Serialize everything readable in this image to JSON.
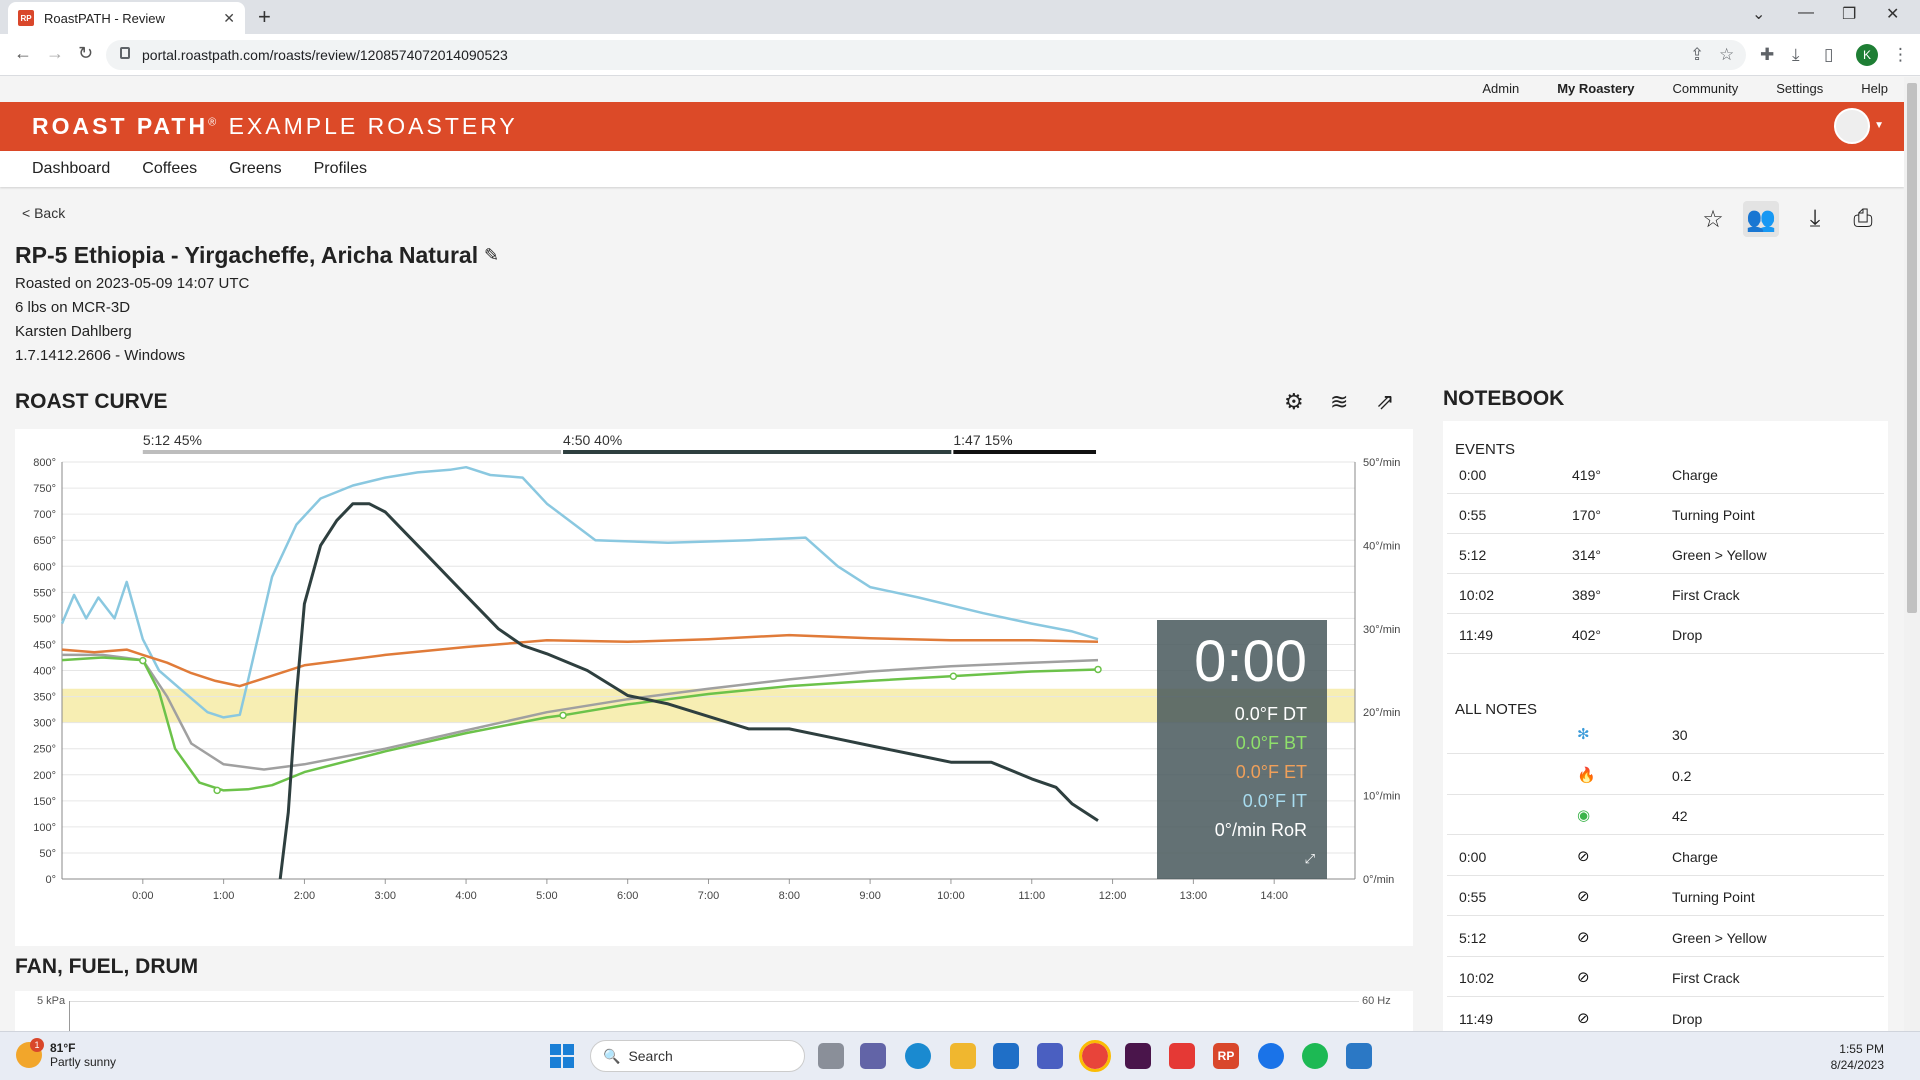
{
  "browser": {
    "tab_title": "RoastPATH - Review",
    "favicon_text": "RP",
    "url": "portal.roastpath.com/roasts/review/1208574072014090523",
    "profile_initial": "K"
  },
  "topnav": [
    "Admin",
    "My Roastery",
    "Community",
    "Settings",
    "Help"
  ],
  "brand": {
    "bold": "ROAST PATH",
    "rest": "EXAMPLE ROASTERY"
  },
  "mainnav": [
    "Dashboard",
    "Coffees",
    "Greens",
    "Profiles"
  ],
  "back_label": "< Back",
  "roast": {
    "title": "RP-5 Ethiopia - Yirgacheffe, Aricha Natural",
    "roasted_on": "Roasted on 2023-05-09 14:07 UTC",
    "batch": "6 lbs on MCR-3D",
    "roaster": "Karsten Dahlberg",
    "version": "1.7.1412.2606 - Windows"
  },
  "sections": {
    "roast_curve": "ROAST CURVE",
    "notebook": "NOTEBOOK",
    "fan_fuel_drum": "FAN, FUEL, DRUM",
    "events": "EVENTS",
    "all_notes": "ALL NOTES"
  },
  "readout": {
    "time": "0:00",
    "dt": "0.0°F DT",
    "bt": "0.0°F BT",
    "et": "0.0°F ET",
    "it": "0.0°F IT",
    "ror": "0°/min RoR"
  },
  "colors": {
    "brand": "#dc4a28",
    "bt": "#6cc24a",
    "et": "#e07b39",
    "it": "#8ac8e0",
    "ror": "#2e3f3f",
    "gray": "#a0a0a0",
    "band": "#f5eaa0"
  },
  "chart_data": {
    "type": "line",
    "xlabel": "",
    "ylabel": "",
    "x_ticks": [
      "0:00",
      "1:00",
      "2:00",
      "3:00",
      "4:00",
      "5:00",
      "6:00",
      "7:00",
      "8:00",
      "9:00",
      "10:00",
      "11:00",
      "12:00",
      "13:00",
      "14:00"
    ],
    "y_ticks": [
      "0°",
      "50°",
      "100°",
      "150°",
      "200°",
      "250°",
      "300°",
      "350°",
      "400°",
      "450°",
      "500°",
      "550°",
      "600°",
      "650°",
      "700°",
      "750°",
      "800°"
    ],
    "y2_ticks": [
      "0°/min",
      "10°/min",
      "20°/min",
      "30°/min",
      "40°/min",
      "50°/min"
    ],
    "xlim": [
      -1,
      15
    ],
    "ylim": [
      0,
      800
    ],
    "y2lim": [
      0,
      50
    ],
    "phases": [
      {
        "label": "5:12 45%",
        "start": 0,
        "end": 5.2,
        "color": "#bdbdbd"
      },
      {
        "label": "4:50 40%",
        "start": 5.2,
        "end": 10.03,
        "color": "#2e3f3f"
      },
      {
        "label": "1:47 15%",
        "start": 10.03,
        "end": 11.82,
        "color": "#111111"
      }
    ],
    "band": [
      300,
      365
    ],
    "series": [
      {
        "key": "it",
        "axis": "left",
        "x": [
          -1,
          -0.85,
          -0.7,
          -0.55,
          -0.35,
          -0.2,
          0,
          0.2,
          0.5,
          0.8,
          1.0,
          1.2,
          1.3,
          1.6,
          1.9,
          2.2,
          2.6,
          3.0,
          3.4,
          3.8,
          4.0,
          4.3,
          4.7,
          5.0,
          5.6,
          6.5,
          7.5,
          8.2,
          8.6,
          9.0,
          9.6,
          10.4,
          11.0,
          11.5,
          11.82
        ],
        "y": [
          490,
          545,
          500,
          540,
          500,
          570,
          460,
          400,
          360,
          320,
          310,
          315,
          380,
          580,
          680,
          730,
          755,
          770,
          780,
          785,
          790,
          775,
          770,
          720,
          650,
          645,
          650,
          655,
          600,
          560,
          540,
          510,
          490,
          475,
          460
        ]
      },
      {
        "key": "et",
        "axis": "left",
        "x": [
          -1,
          -0.6,
          -0.2,
          0,
          0.3,
          0.6,
          0.9,
          1.2,
          1.5,
          2.0,
          3.0,
          4.0,
          5.0,
          6.0,
          7.0,
          8.0,
          9.0,
          10.0,
          11.0,
          11.82
        ],
        "y": [
          440,
          435,
          440,
          430,
          415,
          395,
          380,
          370,
          385,
          410,
          430,
          445,
          458,
          455,
          460,
          468,
          462,
          458,
          458,
          455
        ]
      },
      {
        "key": "gray",
        "axis": "left",
        "x": [
          -1,
          -0.5,
          0,
          0.3,
          0.6,
          1.0,
          1.5,
          2.0,
          3.0,
          4.0,
          5.0,
          6.0,
          7.0,
          8.0,
          9.0,
          10.0,
          11.0,
          11.82
        ],
        "y": [
          430,
          430,
          420,
          350,
          260,
          220,
          210,
          220,
          250,
          285,
          320,
          345,
          365,
          383,
          398,
          408,
          415,
          420
        ]
      },
      {
        "key": "bt",
        "axis": "left",
        "x": [
          -1,
          -0.5,
          0,
          0.2,
          0.4,
          0.7,
          1.0,
          1.3,
          1.6,
          2.0,
          3.0,
          4.0,
          5.0,
          5.2,
          6.0,
          7.0,
          8.0,
          9.0,
          10.0,
          11.0,
          11.82
        ],
        "y": [
          420,
          425,
          420,
          360,
          250,
          185,
          170,
          172,
          180,
          205,
          245,
          280,
          310,
          314,
          335,
          355,
          370,
          380,
          389,
          398,
          402
        ]
      },
      {
        "key": "ror",
        "axis": "right",
        "x": [
          1.7,
          1.8,
          1.9,
          2.0,
          2.2,
          2.4,
          2.6,
          2.8,
          3.0,
          3.2,
          3.5,
          3.8,
          4.1,
          4.4,
          4.7,
          5.0,
          5.5,
          6.0,
          6.5,
          7.0,
          7.5,
          8.0,
          8.5,
          9.0,
          9.5,
          10.0,
          10.5,
          11.0,
          11.3,
          11.5,
          11.82
        ],
        "y": [
          0,
          8,
          22,
          33,
          40,
          43,
          45,
          45,
          44,
          42,
          39,
          36,
          33,
          30,
          28,
          27,
          25,
          22,
          21,
          19.5,
          18,
          18,
          17,
          16,
          15,
          14,
          14,
          12,
          11,
          9,
          7
        ]
      }
    ],
    "markers": [
      {
        "series": "bt",
        "x": 0,
        "y": 419
      },
      {
        "series": "bt",
        "x": 0.92,
        "y": 170
      },
      {
        "series": "bt",
        "x": 5.2,
        "y": 314
      },
      {
        "series": "bt",
        "x": 10.03,
        "y": 389
      },
      {
        "series": "bt",
        "x": 11.82,
        "y": 402
      }
    ]
  },
  "events": [
    {
      "time": "0:00",
      "temp": "419°",
      "name": "Charge"
    },
    {
      "time": "0:55",
      "temp": "170°",
      "name": "Turning Point"
    },
    {
      "time": "5:12",
      "temp": "314°",
      "name": "Green > Yellow"
    },
    {
      "time": "10:02",
      "temp": "389°",
      "name": "First Crack"
    },
    {
      "time": "11:49",
      "temp": "402°",
      "name": "Drop"
    }
  ],
  "notes": [
    {
      "time": "",
      "icon": "fan-icon",
      "value": "30"
    },
    {
      "time": "",
      "icon": "flame-icon",
      "value": "0.2"
    },
    {
      "time": "",
      "icon": "drum-icon",
      "value": "42"
    },
    {
      "time": "0:00",
      "icon": "event-icon",
      "value": "Charge"
    },
    {
      "time": "0:55",
      "icon": "event-icon",
      "value": "Turning Point"
    },
    {
      "time": "5:12",
      "icon": "event-icon",
      "value": "Green > Yellow"
    },
    {
      "time": "10:02",
      "icon": "event-icon",
      "value": "First Crack"
    },
    {
      "time": "11:49",
      "icon": "event-icon",
      "value": "Drop"
    }
  ],
  "ffd_axis": {
    "left": "5 kPa",
    "right": "60 Hz"
  },
  "taskbar": {
    "weather_temp": "81°F",
    "weather_desc": "Partly sunny",
    "weather_badge": "1",
    "search_label": "Search",
    "time": "1:55 PM",
    "date": "8/24/2023"
  }
}
